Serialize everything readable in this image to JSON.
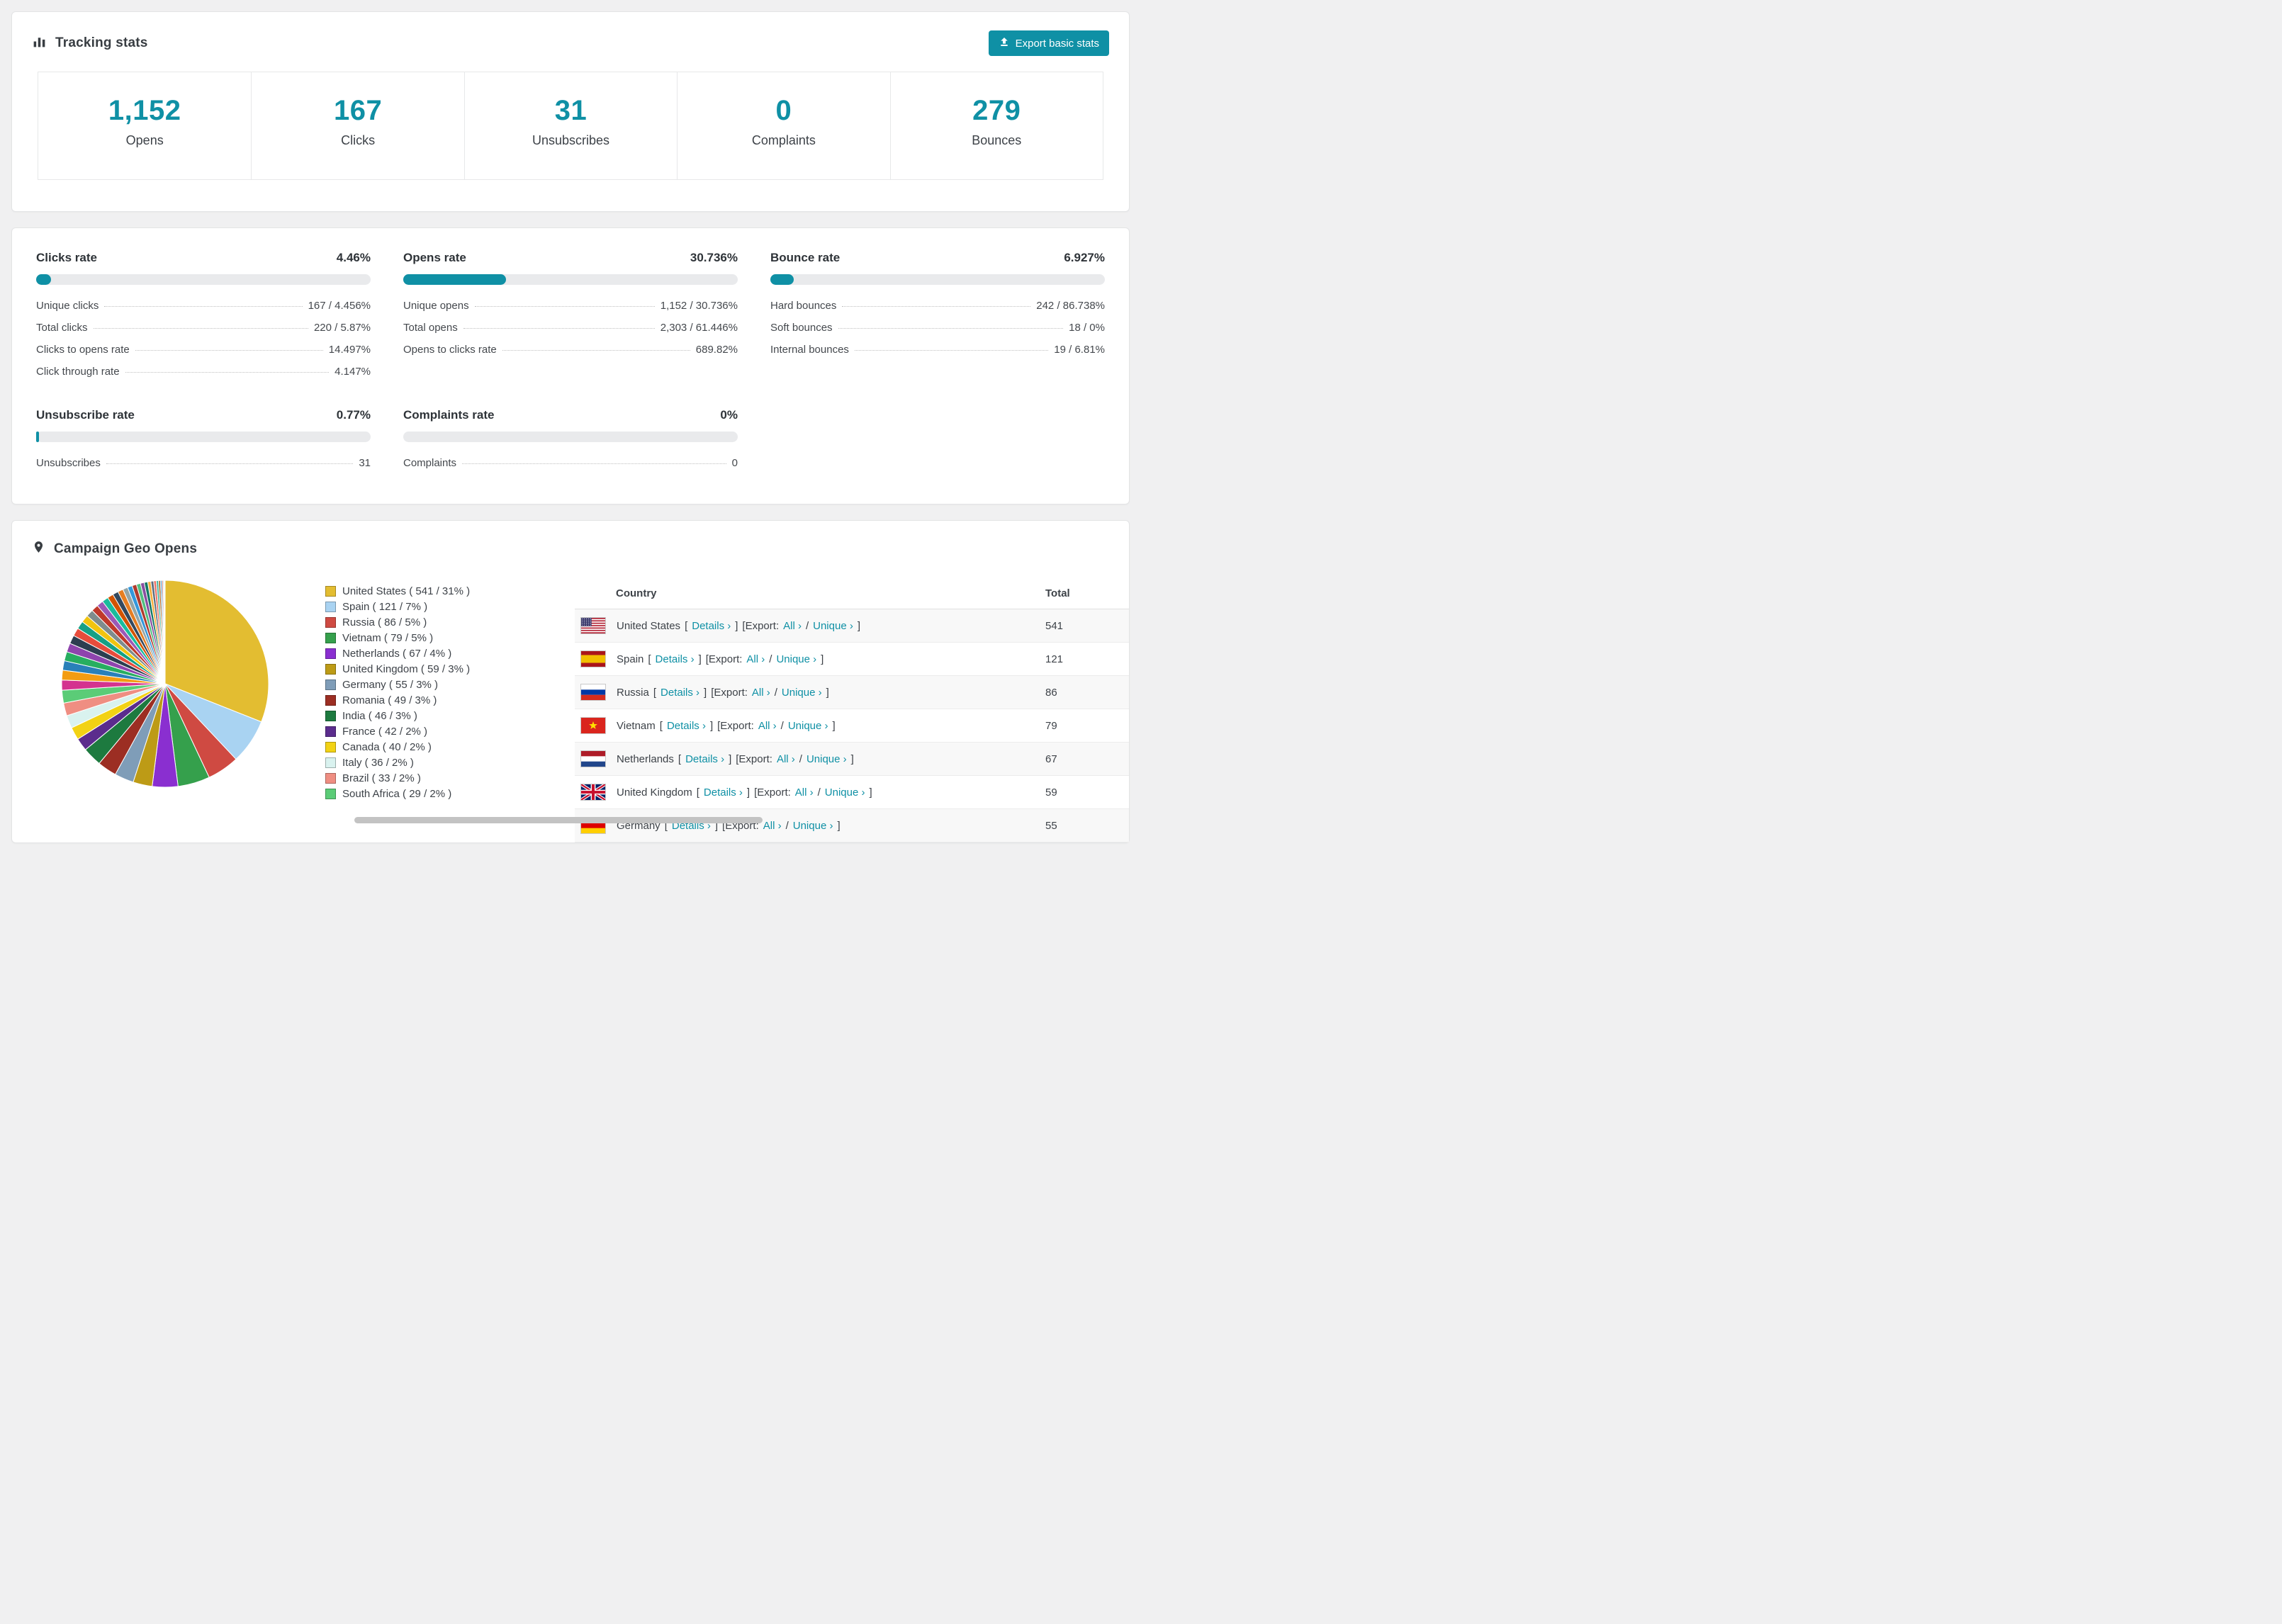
{
  "colors": {
    "accent": "#0f90a5"
  },
  "tracking": {
    "title": "Tracking stats",
    "export_button": "Export basic stats",
    "stats": [
      {
        "value": "1,152",
        "label": "Opens"
      },
      {
        "value": "167",
        "label": "Clicks"
      },
      {
        "value": "31",
        "label": "Unsubscribes"
      },
      {
        "value": "0",
        "label": "Complaints"
      },
      {
        "value": "279",
        "label": "Bounces"
      }
    ]
  },
  "rates": [
    {
      "title": "Clicks rate",
      "percent": "4.46%",
      "bar": 4.46,
      "rows": [
        {
          "label": "Unique clicks",
          "value": "167 / 4.456%"
        },
        {
          "label": "Total clicks",
          "value": "220 / 5.87%"
        },
        {
          "label": "Clicks to opens rate",
          "value": "14.497%"
        },
        {
          "label": "Click through rate",
          "value": "4.147%"
        }
      ]
    },
    {
      "title": "Opens rate",
      "percent": "30.736%",
      "bar": 30.736,
      "rows": [
        {
          "label": "Unique opens",
          "value": "1,152 / 30.736%"
        },
        {
          "label": "Total opens",
          "value": "2,303 / 61.446%"
        },
        {
          "label": "Opens to clicks rate",
          "value": "689.82%"
        }
      ]
    },
    {
      "title": "Bounce rate",
      "percent": "6.927%",
      "bar": 6.927,
      "rows": [
        {
          "label": "Hard bounces",
          "value": "242 / 86.738%"
        },
        {
          "label": "Soft bounces",
          "value": "18 / 0%"
        },
        {
          "label": "Internal bounces",
          "value": "19 / 6.81%"
        }
      ]
    },
    {
      "title": "Unsubscribe rate",
      "percent": "0.77%",
      "bar": 0.77,
      "rows": [
        {
          "label": "Unsubscribes",
          "value": "31"
        }
      ]
    },
    {
      "title": "Complaints rate",
      "percent": "0%",
      "bar": 0,
      "rows": [
        {
          "label": "Complaints",
          "value": "0"
        }
      ]
    }
  ],
  "geo": {
    "title": "Campaign Geo Opens",
    "table": {
      "columns": [
        "Country",
        "Total"
      ],
      "labels": {
        "details": "Details",
        "export": "Export:",
        "all": "All",
        "unique": "Unique",
        "chevron": "›"
      },
      "rows": [
        {
          "country": "United States",
          "total": "541",
          "flag": "us"
        },
        {
          "country": "Spain",
          "total": "121",
          "flag": "es"
        },
        {
          "country": "Russia",
          "total": "86",
          "flag": "ru"
        },
        {
          "country": "Vietnam",
          "total": "79",
          "flag": "vn"
        },
        {
          "country": "Netherlands",
          "total": "67",
          "flag": "nl"
        },
        {
          "country": "United Kingdom",
          "total": "59",
          "flag": "gb"
        },
        {
          "country": "Germany",
          "total": "55",
          "flag": "de"
        }
      ]
    }
  },
  "chart_data": {
    "type": "pie",
    "title": "Campaign Geo Opens",
    "slices": [
      {
        "label": "United States",
        "value": 541,
        "percent": 31,
        "color": "#e3bd31"
      },
      {
        "label": "Spain",
        "value": 121,
        "percent": 7,
        "color": "#a9d3f2"
      },
      {
        "label": "Russia",
        "value": 86,
        "percent": 5,
        "color": "#cf4a42"
      },
      {
        "label": "Vietnam",
        "value": 79,
        "percent": 5,
        "color": "#35a04c"
      },
      {
        "label": "Netherlands",
        "value": 67,
        "percent": 4,
        "color": "#8a2fd0"
      },
      {
        "label": "United Kingdom",
        "value": 59,
        "percent": 3,
        "color": "#bd9b16"
      },
      {
        "label": "Germany",
        "value": 55,
        "percent": 3,
        "color": "#7f9db8"
      },
      {
        "label": "Romania",
        "value": 49,
        "percent": 3,
        "color": "#9c2e23"
      },
      {
        "label": "India",
        "value": 46,
        "percent": 3,
        "color": "#1d7a3f"
      },
      {
        "label": "France",
        "value": 42,
        "percent": 2,
        "color": "#5b2c8d"
      },
      {
        "label": "Canada",
        "value": 40,
        "percent": 2,
        "color": "#f2d214"
      },
      {
        "label": "Italy",
        "value": 36,
        "percent": 2,
        "color": "#d9f2ef"
      },
      {
        "label": "Brazil",
        "value": 33,
        "percent": 2,
        "color": "#ef8e82"
      },
      {
        "label": "South Africa",
        "value": 29,
        "percent": 2,
        "color": "#5bcc77"
      }
    ],
    "others": {
      "percent": 26,
      "colors": [
        "#d4338f",
        "#f39c12",
        "#2980b9",
        "#27ae60",
        "#8e44ad",
        "#2c3e50",
        "#e74c3c",
        "#16a085",
        "#f1c40f",
        "#7f8c8d",
        "#c0392b",
        "#9b59b6",
        "#1abc9c",
        "#d35400",
        "#34495e",
        "#e67e22",
        "#95a5a6",
        "#3498db",
        "#b03a2e",
        "#52be80",
        "#884ea0",
        "#117864",
        "#f5b041",
        "#5d6d7e",
        "#ec7063",
        "#45b39d",
        "#af601a",
        "#5499c7",
        "#cd6155",
        "#48c9b0",
        "#7d3c98",
        "#229954"
      ]
    }
  }
}
